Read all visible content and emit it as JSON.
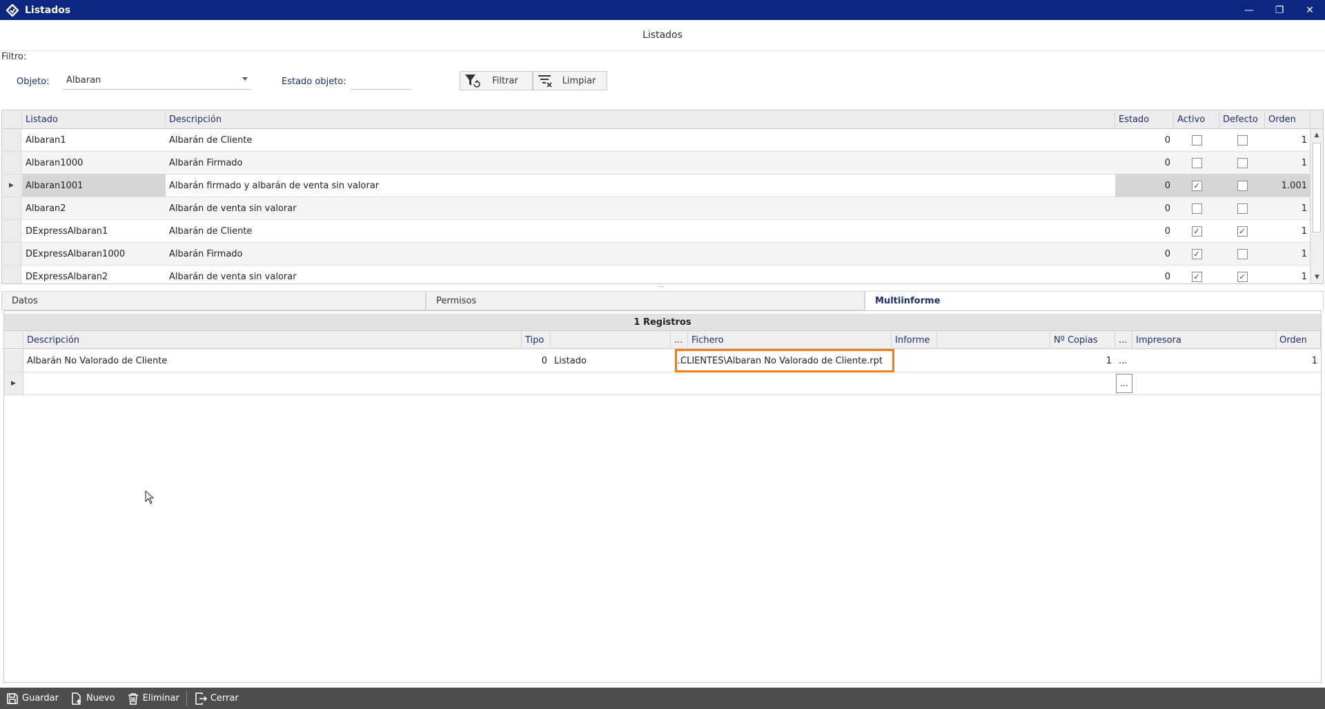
{
  "window": {
    "title": "Listados",
    "minimize_glyph": "—",
    "restore_glyph": "❐",
    "close_glyph": "✕"
  },
  "header": {
    "title": "Listados"
  },
  "filter": {
    "label": "Filtro:",
    "objeto_label": "Objeto:",
    "objeto_value": "Albaran",
    "estado_label": "Estado objeto:",
    "estado_value": "",
    "filtrar_label": "Filtrar",
    "limpiar_label": "Limpiar"
  },
  "listados_grid": {
    "columns": [
      "Listado",
      "Descripción",
      "Estado",
      "Activo",
      "Defecto",
      "Orden"
    ],
    "rows": [
      {
        "listado": "Albaran1",
        "descripcion": "Albarán de Cliente",
        "estado": "0",
        "activo": false,
        "defecto": false,
        "orden": "1"
      },
      {
        "listado": "Albaran1000",
        "descripcion": "Albarán Firmado",
        "estado": "0",
        "activo": false,
        "defecto": false,
        "orden": "1"
      },
      {
        "listado": "Albaran1001",
        "descripcion": "Albarán firmado y albarán de venta sin valorar",
        "estado": "0",
        "activo": true,
        "defecto": false,
        "orden": "1.001",
        "selected": true
      },
      {
        "listado": "Albaran2",
        "descripcion": "Albarán de venta sin valorar",
        "estado": "0",
        "activo": false,
        "defecto": false,
        "orden": "1"
      },
      {
        "listado": "DExpressAlbaran1",
        "descripcion": "Albarán de Cliente",
        "estado": "0",
        "activo": true,
        "defecto": true,
        "orden": "1"
      },
      {
        "listado": "DExpressAlbaran1000",
        "descripcion": "Albarán Firmado",
        "estado": "0",
        "activo": true,
        "defecto": false,
        "orden": "1"
      },
      {
        "listado": "DExpressAlbaran2",
        "descripcion": "Albarán de venta sin valorar",
        "estado": "0",
        "activo": true,
        "defecto": true,
        "orden": "1"
      }
    ]
  },
  "tabs": [
    {
      "label": "Datos",
      "active": false
    },
    {
      "label": "Permisos",
      "active": false
    },
    {
      "label": "Multiinforme",
      "active": true
    }
  ],
  "multiinforme": {
    "records_label": "1 Registros",
    "columns": [
      "Descripción",
      "Tipo",
      "",
      "...",
      "Fichero",
      "Informe",
      "",
      "Nº Copias",
      "...",
      "Impresora",
      "Orden"
    ],
    "rows": [
      {
        "descripcion": "Albarán No Valorado de Cliente",
        "tipo": "0",
        "tipo_nombre": "Listado",
        "ell1": "...",
        "fichero": "CLIENTES\\Albaran No Valorado de Cliente.rpt",
        "informe": "",
        "copias": "1",
        "ell2": "...",
        "impresora": "",
        "orden": "1"
      }
    ],
    "new_row_ell": "..."
  },
  "bottom_toolbar": {
    "guardar": "Guardar",
    "nuevo": "Nuevo",
    "eliminar": "Eliminar",
    "cerrar": "Cerrar"
  },
  "colors": {
    "titlebar": "#0d2680",
    "accent_text": "#1b2f73",
    "highlight": "#ef7d1a",
    "bottombar": "#4e4e4e"
  }
}
